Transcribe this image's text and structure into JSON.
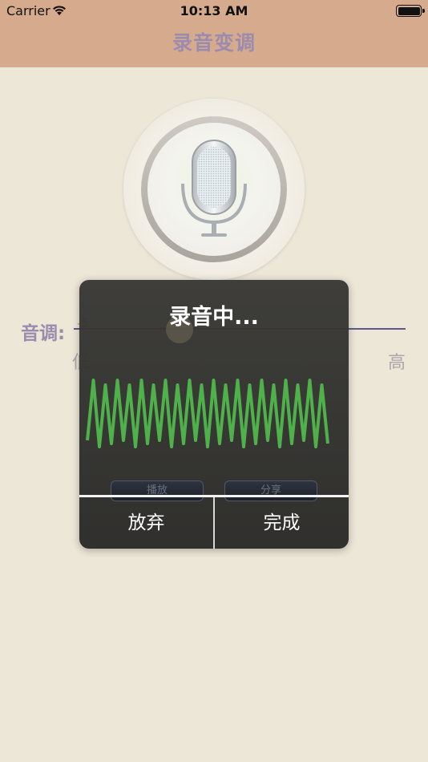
{
  "status_bar": {
    "carrier": "Carrier",
    "time": "10:13 AM"
  },
  "nav": {
    "title": "录音变调"
  },
  "pitch": {
    "label": "音调:",
    "value": "-5",
    "low_label": "低",
    "high_label": "高"
  },
  "dialog": {
    "title": "录音中...",
    "ghost_play": "播放",
    "ghost_share": "分享",
    "abandon_label": "放弃",
    "done_label": "完成"
  },
  "colors": {
    "nav_bg": "#d6ab8d",
    "page_bg": "#ede7d8",
    "wave": "#4fb14a",
    "title_text": "#9b8cae"
  }
}
